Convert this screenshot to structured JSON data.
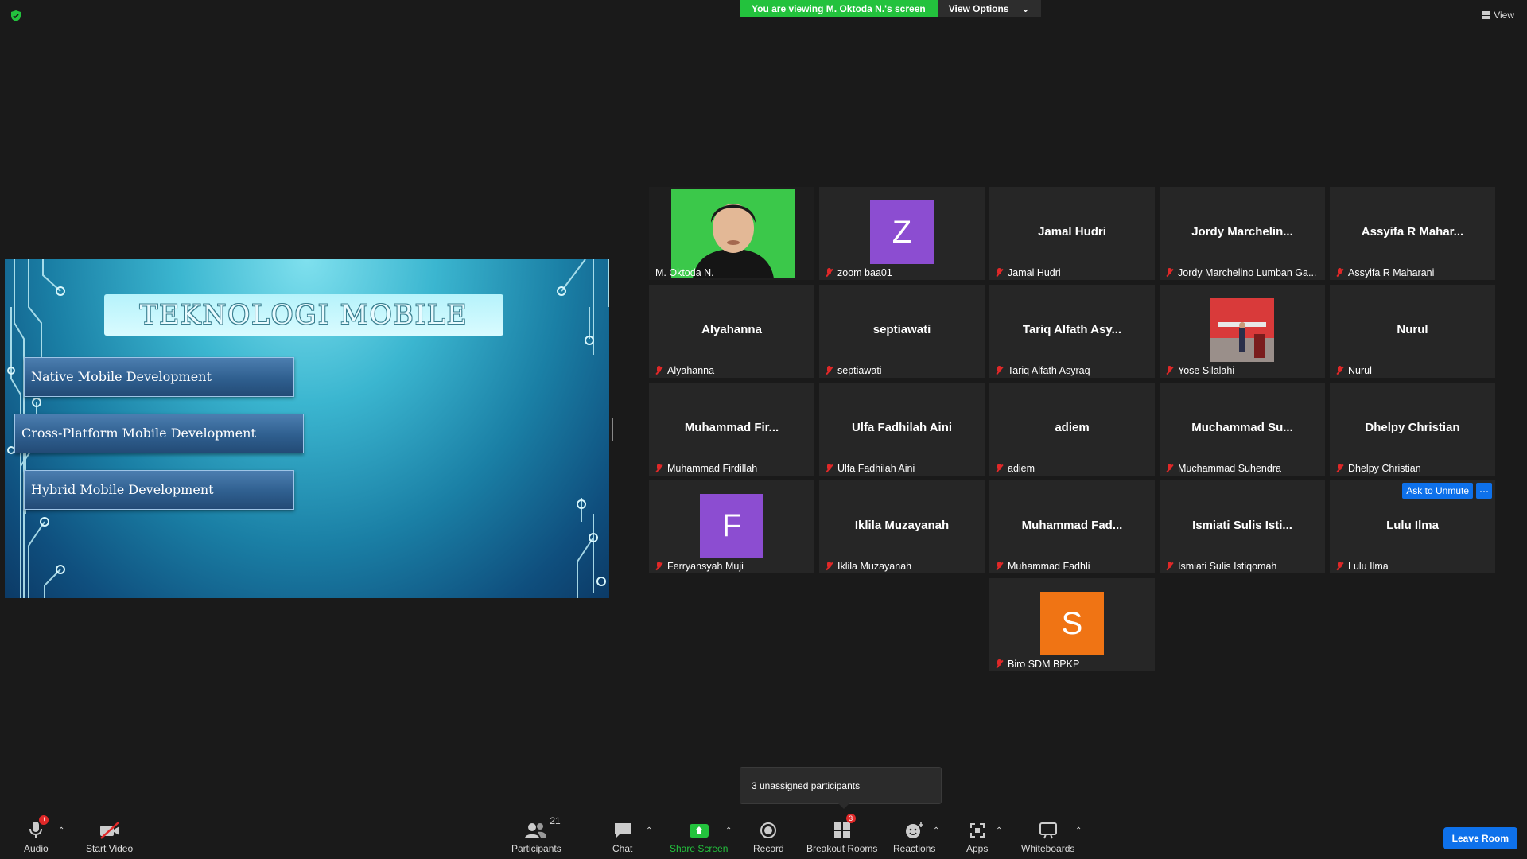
{
  "banner": {
    "viewing_text": "You are viewing M. Oktoda N.'s screen",
    "view_options": "View Options"
  },
  "top_right": {
    "view_label": "View"
  },
  "slide": {
    "title": "TEKNOLOGI MOBILE",
    "items": [
      "Native Mobile Development",
      "Cross-Platform Mobile Development",
      "Hybrid Mobile Development"
    ]
  },
  "participants": [
    {
      "center": "",
      "label": "M. Oktoda N.",
      "muted": false,
      "active": true,
      "avatar": "photo"
    },
    {
      "center": "",
      "label": "zoom baa01",
      "muted": true,
      "avatar": "letter",
      "letter": "Z",
      "color": "#8c4dd1"
    },
    {
      "center": "Jamal Hudri",
      "label": "Jamal Hudri",
      "muted": true
    },
    {
      "center": "Jordy  Marchelin...",
      "label": "Jordy Marchelino Lumban Ga...",
      "muted": true
    },
    {
      "center": "Assyifa R Mahar...",
      "label": "Assyifa R Maharani",
      "muted": true
    },
    {
      "center": "Alyahanna",
      "label": "Alyahanna",
      "muted": true
    },
    {
      "center": "septiawati",
      "label": "septiawati",
      "muted": true
    },
    {
      "center": "Tariq Alfath Asy...",
      "label": "Tariq Alfath Asyraq",
      "muted": true
    },
    {
      "center": "",
      "label": "Yose Silalahi",
      "muted": true,
      "avatar": "photo2"
    },
    {
      "center": "Nurul",
      "label": "Nurul",
      "muted": true
    },
    {
      "center": "Muhammad  Fir...",
      "label": "Muhammad Firdillah",
      "muted": true
    },
    {
      "center": "Ulfa Fadhilah Aini",
      "label": "Ulfa Fadhilah Aini",
      "muted": true
    },
    {
      "center": "adiem",
      "label": "adiem",
      "muted": true
    },
    {
      "center": "Muchammad  Su...",
      "label": "Muchammad Suhendra",
      "muted": true
    },
    {
      "center": "Dhelpy Christian",
      "label": "Dhelpy Christian",
      "muted": true
    },
    {
      "center": "",
      "label": "Ferryansyah Muji",
      "muted": true,
      "avatar": "letter",
      "letter": "F",
      "color": "#8c4dd1"
    },
    {
      "center": "Iklila Muzayanah",
      "label": "Iklila Muzayanah",
      "muted": true
    },
    {
      "center": "Muhammad  Fad...",
      "label": "Muhammad Fadhli",
      "muted": true
    },
    {
      "center": "Ismiati Sulis Isti...",
      "label": "Ismiati Sulis Istiqomah",
      "muted": true
    },
    {
      "center": "Lulu Ilma",
      "label": "Lulu Ilma",
      "muted": true,
      "ask_unmute": "Ask to Unmute",
      "more": "···"
    },
    {
      "center": "",
      "label": "Biro SDM BPKP",
      "muted": true,
      "avatar": "letter",
      "letter": "S",
      "color": "#f07414"
    }
  ],
  "tooltip": "3 unassigned participants",
  "toolbar": {
    "audio": "Audio",
    "audio_badge": "!",
    "start_video": "Start Video",
    "participants": "Participants",
    "participants_count": "21",
    "chat": "Chat",
    "share_screen": "Share Screen",
    "record": "Record",
    "breakout_rooms": "Breakout Rooms",
    "breakout_badge": "3",
    "reactions": "Reactions",
    "apps": "Apps",
    "whiteboards": "Whiteboards",
    "leave_room": "Leave Room"
  }
}
